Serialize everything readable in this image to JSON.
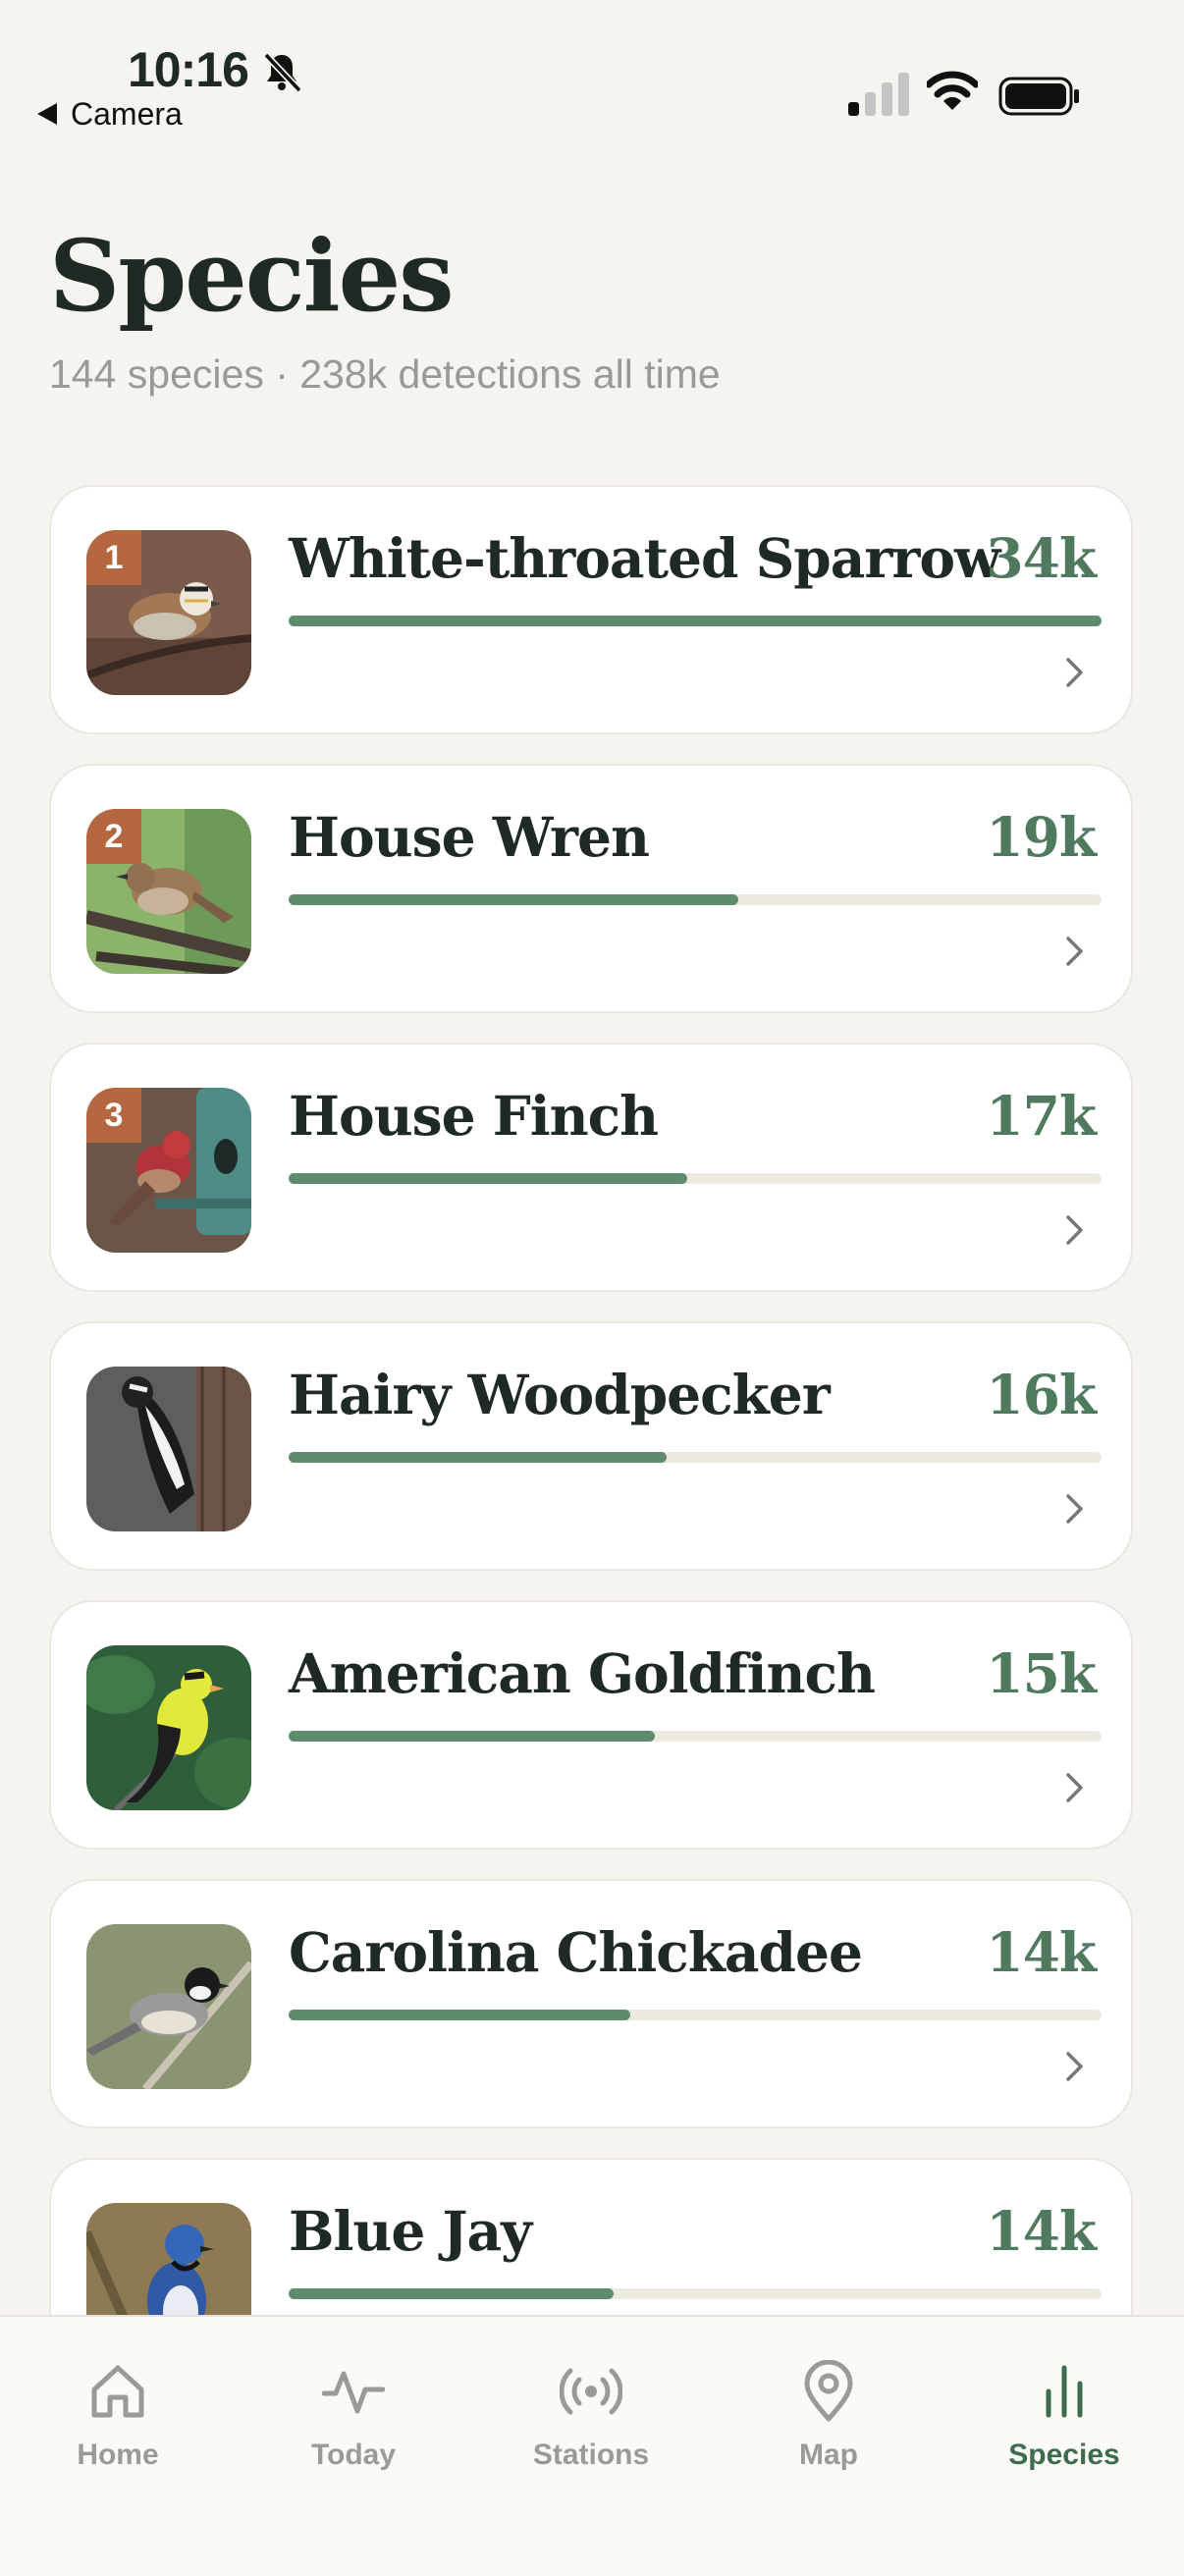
{
  "status_bar": {
    "time": "10:16",
    "back_label": "Camera",
    "icons": [
      "bell-slash-icon",
      "cellular-signal-icon",
      "wifi-icon",
      "battery-icon"
    ]
  },
  "header": {
    "title": "Species",
    "subtitle": "144 species · 238k detections all time"
  },
  "species": [
    {
      "rank": "1",
      "name": "White-throated Sparrow",
      "count": "34k",
      "fill": 1.0,
      "image": "white-throated-sparrow-photo"
    },
    {
      "rank": "2",
      "name": "House Wren",
      "count": "19k",
      "fill": 0.553,
      "image": "house-wren-photo"
    },
    {
      "rank": "3",
      "name": "House Finch",
      "count": "17k",
      "fill": 0.49,
      "image": "house-finch-photo"
    },
    {
      "rank": "",
      "name": "Hairy Woodpecker",
      "count": "16k",
      "fill": 0.465,
      "image": "hairy-woodpecker-photo"
    },
    {
      "rank": "",
      "name": "American Goldfinch",
      "count": "15k",
      "fill": 0.45,
      "image": "american-goldfinch-photo"
    },
    {
      "rank": "",
      "name": "Carolina Chickadee",
      "count": "14k",
      "fill": 0.42,
      "image": "carolina-chickadee-photo"
    },
    {
      "rank": "",
      "name": "Blue Jay",
      "count": "14k",
      "fill": 0.4,
      "image": "blue-jay-photo"
    }
  ],
  "tabs": [
    {
      "label": "Home",
      "icon": "home-icon",
      "active": false
    },
    {
      "label": "Today",
      "icon": "activity-pulse-icon",
      "active": false
    },
    {
      "label": "Stations",
      "icon": "broadcast-icon",
      "active": false
    },
    {
      "label": "Map",
      "icon": "map-pin-icon",
      "active": false
    },
    {
      "label": "Species",
      "icon": "bar-chart-icon",
      "active": true
    }
  ],
  "colors": {
    "background": "#f5f4ef",
    "accent": "#5e8a6d",
    "count_text": "#4f7a5e",
    "rank_badge": "#b5673f",
    "active_tab": "#3d6b4d"
  }
}
